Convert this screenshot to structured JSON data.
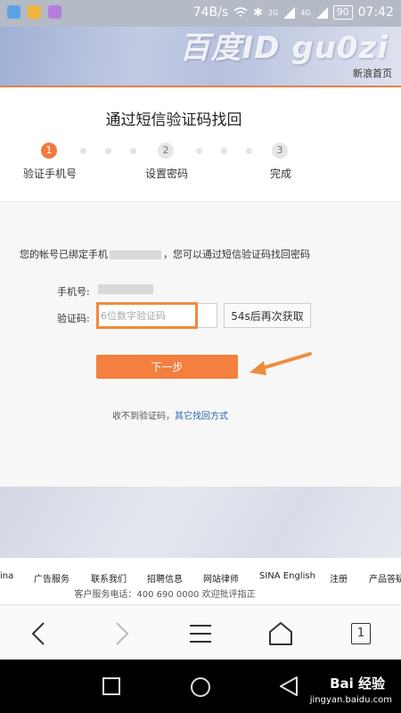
{
  "status_bar": {
    "network_speed": "74B/s",
    "signal_2g": "2G",
    "signal_4g": "4G",
    "battery": "90",
    "time": "07:42"
  },
  "header": {
    "watermark": "百度ID gu0zi",
    "home_link": "新浪首页"
  },
  "page_title": "通过短信验证码找回",
  "steps": [
    {
      "number": "1",
      "label": "验证手机号",
      "active": true
    },
    {
      "number": "2",
      "label": "设置密码",
      "active": false
    },
    {
      "number": "3",
      "label": "完成",
      "active": false
    }
  ],
  "form": {
    "notice_prefix": "您的帐号已绑定手机",
    "notice_suffix": "，您可以通过短信验证码找回密码",
    "phone_label": "手机号:",
    "code_label": "验证码:",
    "code_placeholder": "6位数字验证码",
    "resend_label": "54s后再次获取",
    "next_label": "下一步",
    "no_code_text": "收不到验证码，",
    "other_method_link": "其它找回方式"
  },
  "footer": {
    "links": [
      "ina",
      "广告服务",
      "联系我们",
      "招聘信息",
      "网站律师",
      "SINA English",
      "注册",
      "产品答疑"
    ],
    "service_text": "客户服务电话：400 690 0000 欢迎批评指正"
  },
  "toolbar": {
    "tab_count": "1"
  },
  "watermark_bottom": {
    "brand": "Bai 经验",
    "url": "jingyan.baidu.com"
  },
  "colors": {
    "accent": "#f47f3f",
    "highlight": "#f08b3c",
    "link": "#2d64b3"
  }
}
